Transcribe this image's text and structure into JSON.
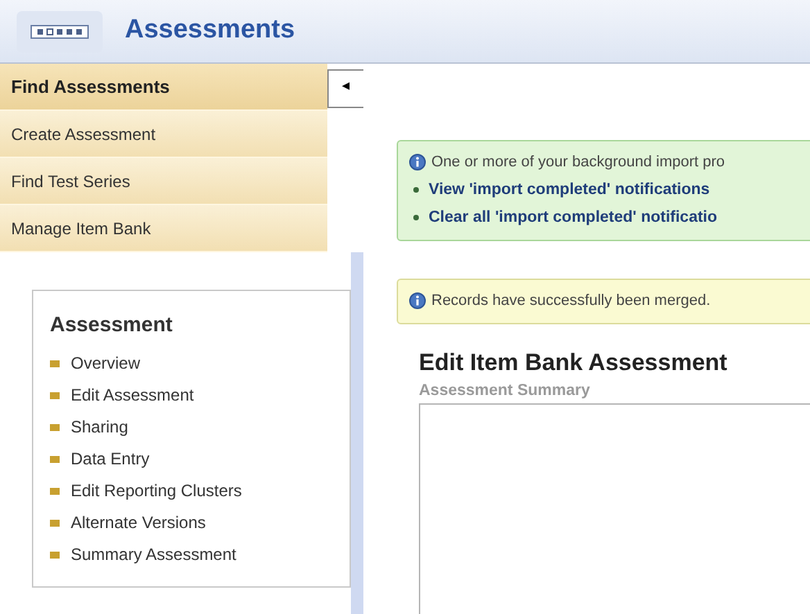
{
  "header": {
    "title": "Assessments"
  },
  "nav": [
    {
      "label": "Find Assessments",
      "selected": true
    },
    {
      "label": "Create Assessment",
      "selected": false
    },
    {
      "label": "Find Test Series",
      "selected": false
    },
    {
      "label": "Manage Item Bank",
      "selected": false
    }
  ],
  "collapse_button": {
    "label": "◂"
  },
  "assessment_panel": {
    "title": "Assessment",
    "links": [
      "Overview",
      "Edit Assessment",
      "Sharing",
      "Data Entry",
      "Edit Reporting Clusters",
      "Alternate Versions",
      "Summary Assessment"
    ]
  },
  "messages": [
    {
      "kind": "success",
      "text": "One or more of your background import pro",
      "links": [
        "View 'import completed' notifications",
        "Clear all 'import completed' notificatio"
      ]
    },
    {
      "kind": "notice",
      "text": "Records have successfully been merged."
    }
  ],
  "page": {
    "title": "Edit Item Bank Assessment",
    "field_label": "Assessment Summary"
  }
}
